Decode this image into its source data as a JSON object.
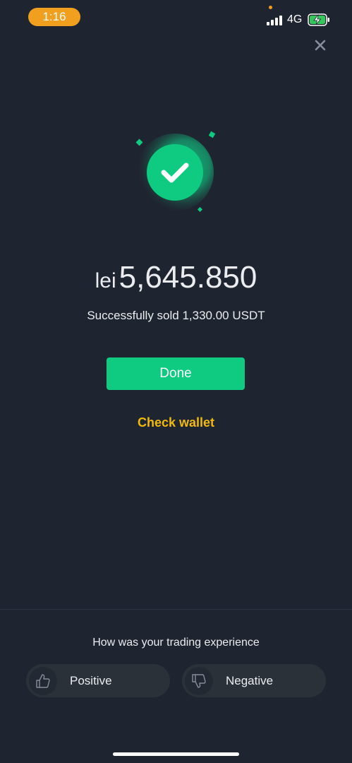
{
  "status_bar": {
    "time": "1:16",
    "network": "4G",
    "icons": [
      "signal-icon",
      "battery-charging-icon"
    ]
  },
  "header": {
    "close_icon": "close-icon"
  },
  "result": {
    "currency": "lei",
    "amount": "5,645.850",
    "message": "Successfully sold 1,330.00 USDT",
    "icon": "check-circle-icon"
  },
  "actions": {
    "done_label": "Done",
    "check_wallet_label": "Check wallet"
  },
  "feedback": {
    "question": "How was your trading experience",
    "positive_label": "Positive",
    "negative_label": "Negative",
    "positive_icon": "thumbs-up-icon",
    "negative_icon": "thumbs-down-icon"
  },
  "colors": {
    "background": "#1f2530",
    "success_green": "#0ecb81",
    "link_yellow": "#f0b90b",
    "time_pill": "#f0a01e"
  }
}
